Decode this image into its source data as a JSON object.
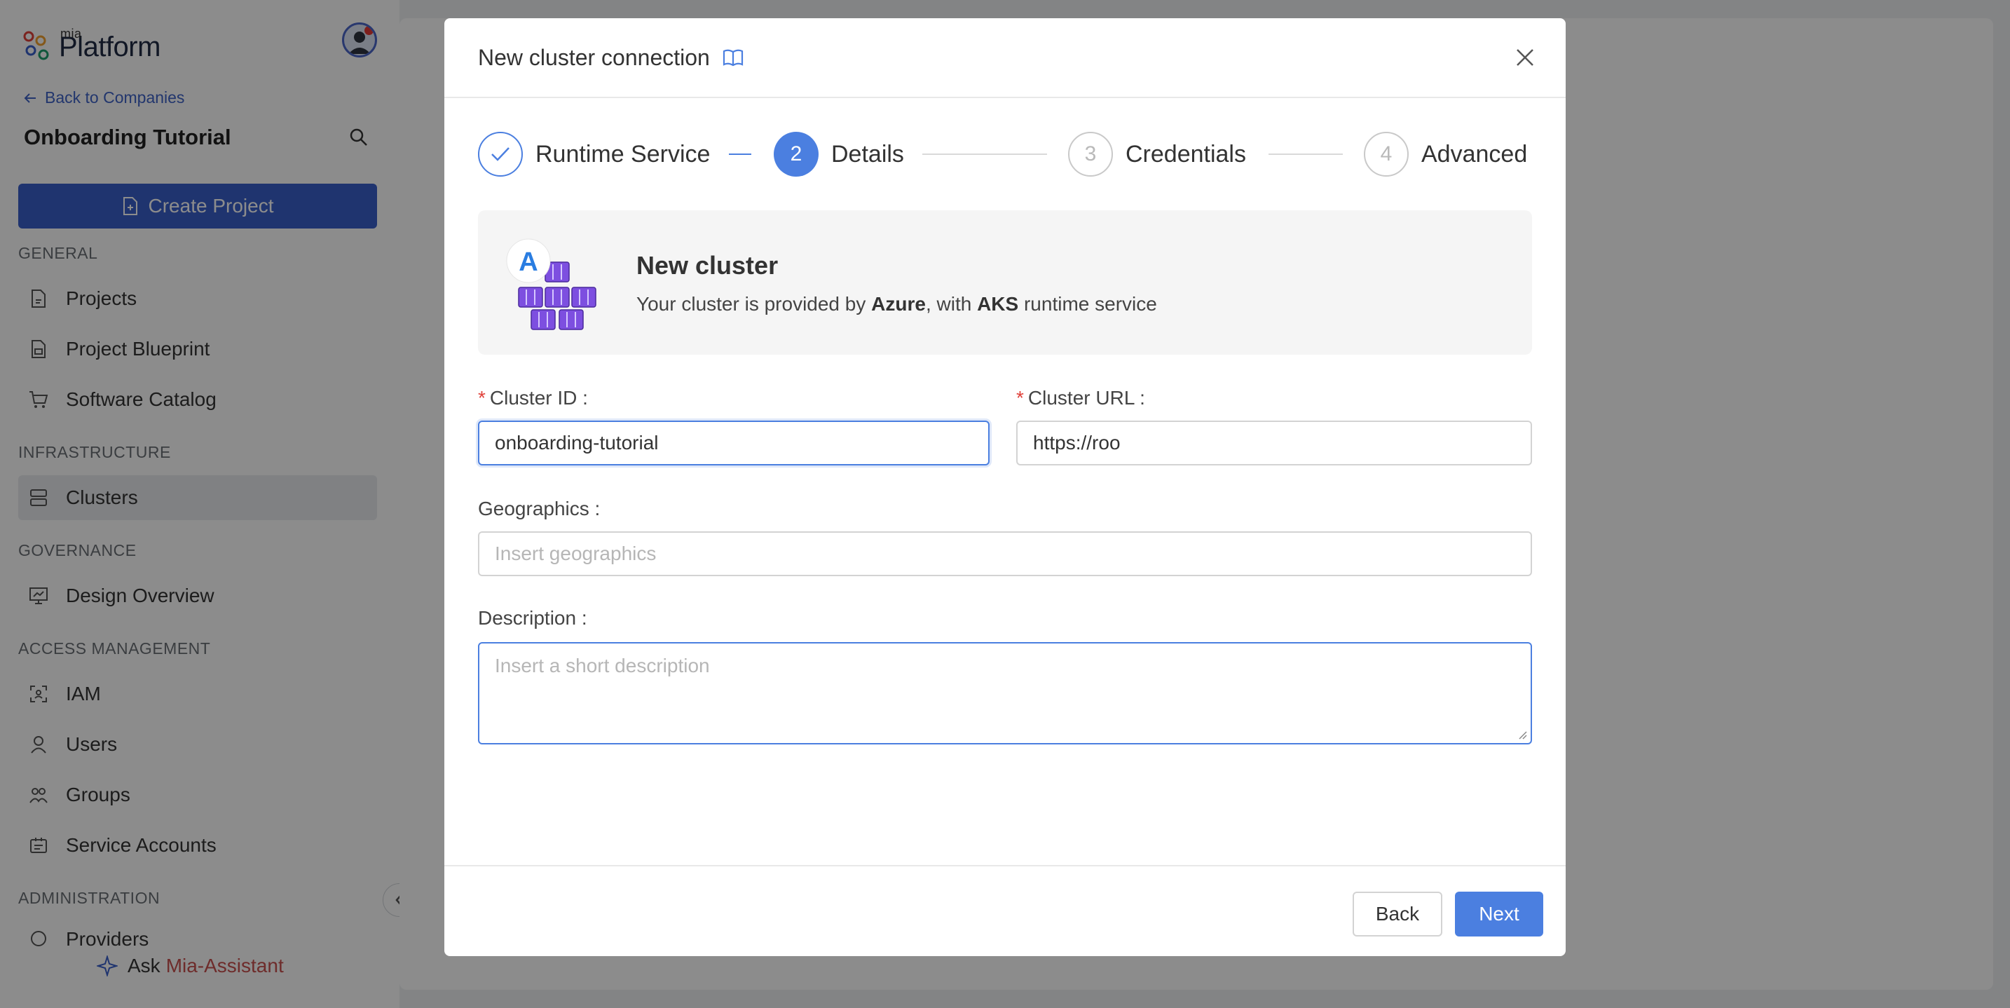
{
  "sidebar": {
    "logo_small": "mia",
    "logo_large": "Platform",
    "back_link": "Back to Companies",
    "company_name": "Onboarding Tutorial",
    "create_project": "Create Project",
    "sections": {
      "general": "GENERAL",
      "infrastructure": "INFRASTRUCTURE",
      "governance": "GOVERNANCE",
      "access_management": "ACCESS MANAGEMENT",
      "administration": "ADMINISTRATION"
    },
    "items": {
      "projects": "Projects",
      "project_blueprint": "Project Blueprint",
      "software_catalog": "Software Catalog",
      "clusters": "Clusters",
      "design_overview": "Design Overview",
      "iam": "IAM",
      "users": "Users",
      "groups": "Groups",
      "service_accounts": "Service Accounts",
      "providers": "Providers"
    },
    "active_item": "Clusters",
    "assistant_prefix": "Ask",
    "assistant_name": "Mia-Assistant"
  },
  "modal": {
    "title": "New cluster connection",
    "steps": [
      {
        "number": "1",
        "label": "Runtime Service",
        "status": "done"
      },
      {
        "number": "2",
        "label": "Details",
        "status": "current"
      },
      {
        "number": "3",
        "label": "Credentials",
        "status": "pending"
      },
      {
        "number": "4",
        "label": "Advanced",
        "status": "pending"
      }
    ],
    "card": {
      "title": "New cluster",
      "desc_prefix": "Your cluster is provided by",
      "provider": "Azure",
      "desc_middle": ", with",
      "runtime": "AKS",
      "desc_suffix": "runtime service",
      "badge_letter": "A"
    },
    "fields": {
      "cluster_id_label": "Cluster ID",
      "cluster_id_value": "onboarding-tutorial",
      "cluster_url_label": "Cluster URL",
      "cluster_url_value": "https://roo",
      "geographics_label": "Geographics",
      "geographics_placeholder": "Insert geographics",
      "description_label": "Description",
      "description_placeholder": "Insert a short description"
    },
    "buttons": {
      "back": "Back",
      "next": "Next"
    }
  },
  "colors": {
    "primary": "#4b7fe0",
    "sidebar_button": "#3a5fcb",
    "required": "#e0413a",
    "assistant_brand": "#c8504f"
  }
}
